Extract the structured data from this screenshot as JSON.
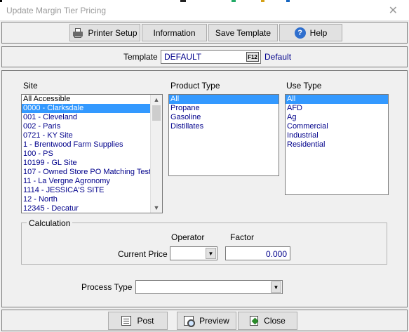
{
  "window": {
    "title": "Update Margin Tier Pricing",
    "close_glyph": "✕"
  },
  "toolbar": {
    "printer_setup": "Printer Setup",
    "information": "Information",
    "save_template": "Save Template",
    "help": "Help"
  },
  "template": {
    "label": "Template",
    "value": "DEFAULT",
    "f12": "F12",
    "description": "Default"
  },
  "site": {
    "label": "Site",
    "items": [
      "All Accessible",
      "0000 - Clarksdale",
      "001 - Cleveland",
      "002 - Paris",
      "0721 - KY Site",
      "1 - Brentwood Farm Supplies",
      "100 - PS",
      "10199 - GL Site",
      "107 - Owned Store PO Matching Test",
      "11 - La Vergne Agronomy",
      "1114 - JESSICA'S SITE",
      "12 - North",
      "12345 - Decatur"
    ],
    "selected_index": 1
  },
  "product_type": {
    "label": "Product Type",
    "items": [
      "All",
      "Propane",
      "Gasoline",
      "Distillates"
    ],
    "selected_index": 0
  },
  "use_type": {
    "label": "Use Type",
    "items": [
      "All",
      "AFD",
      "Ag",
      "Commercial",
      "Industrial",
      "Residential"
    ],
    "selected_index": 0
  },
  "calculation": {
    "legend": "Calculation",
    "operator_label": "Operator",
    "factor_label": "Factor",
    "current_price_label": "Current Price",
    "operator_value": "",
    "factor_value": "0.000"
  },
  "process_type": {
    "label": "Process Type",
    "value": ""
  },
  "bottom": {
    "post": "Post",
    "preview": "Preview",
    "close": "Close"
  },
  "colors": {
    "selection": "#3399ff",
    "value_text": "#00008b"
  }
}
